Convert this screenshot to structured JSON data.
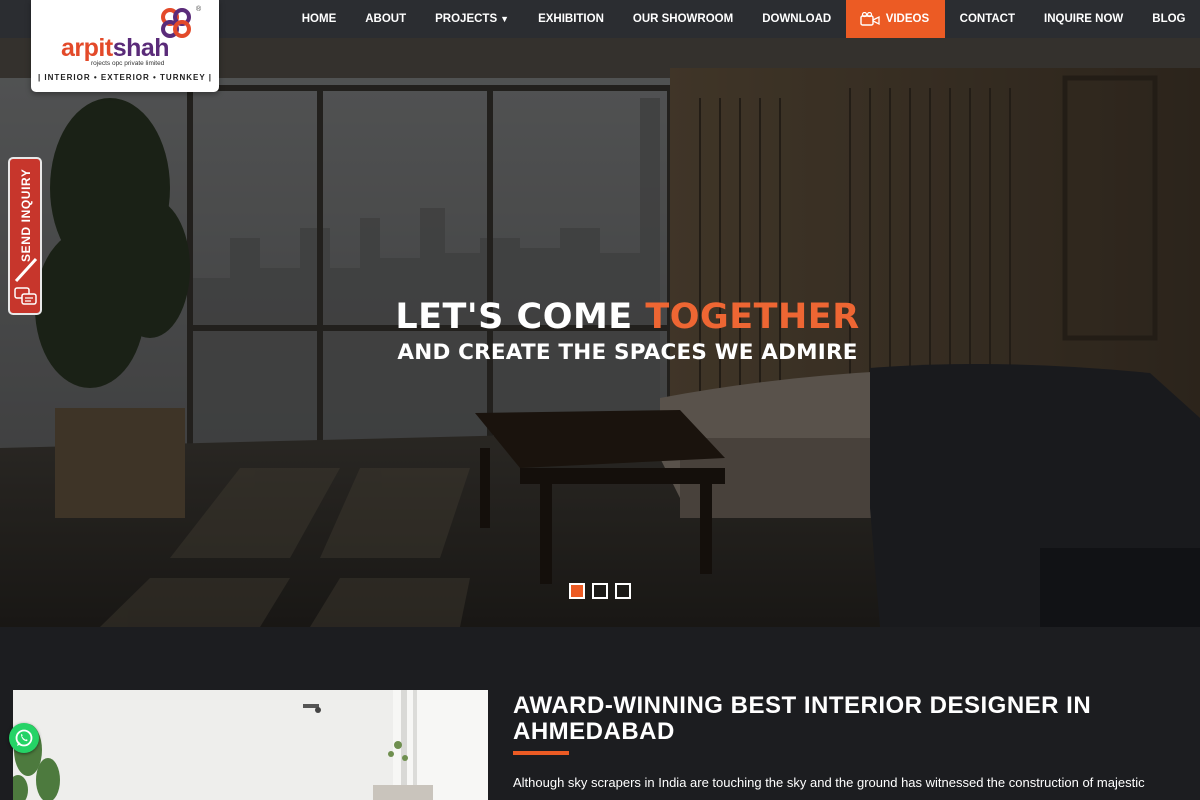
{
  "brand": {
    "name_part1": "arpit",
    "name_part2": "shah",
    "subline": "rojects opc private limited",
    "tagline": "| INTERIOR • EXTERIOR • TURNKEY |",
    "registered": "®",
    "colors": {
      "red": "#e34a2a",
      "purple": "#5a2b79"
    }
  },
  "nav": {
    "items": [
      {
        "label": "HOME"
      },
      {
        "label": "ABOUT"
      },
      {
        "label": "PROJECTS",
        "caret": "▼"
      },
      {
        "label": "EXHIBITION"
      },
      {
        "label": "OUR SHOWROOM"
      },
      {
        "label": "DOWNLOAD"
      },
      {
        "label": "VIDEOS",
        "icon": "video-camera-icon",
        "active": true
      },
      {
        "label": "CONTACT"
      },
      {
        "label": "INQUIRE NOW"
      },
      {
        "label": "BLOG"
      }
    ],
    "accent": "#ec5b24"
  },
  "hero": {
    "title_main": "LET'S COME ",
    "title_accent": "TOGETHER",
    "subtitle": "AND CREATE THE SPACES WE ADMIRE",
    "slides": [
      {
        "active": true
      },
      {
        "active": false
      },
      {
        "active": false
      }
    ]
  },
  "side_tab": {
    "label": "SEND INQUIRY",
    "icon": "chat-icon"
  },
  "about": {
    "heading": "AWARD-WINNING BEST INTERIOR DESIGNER IN AHMEDABAD",
    "text": "Although sky scrapers in India are touching the sky and the ground has witnessed the construction of majestic"
  },
  "whatsapp": {
    "icon": "whatsapp-icon"
  }
}
